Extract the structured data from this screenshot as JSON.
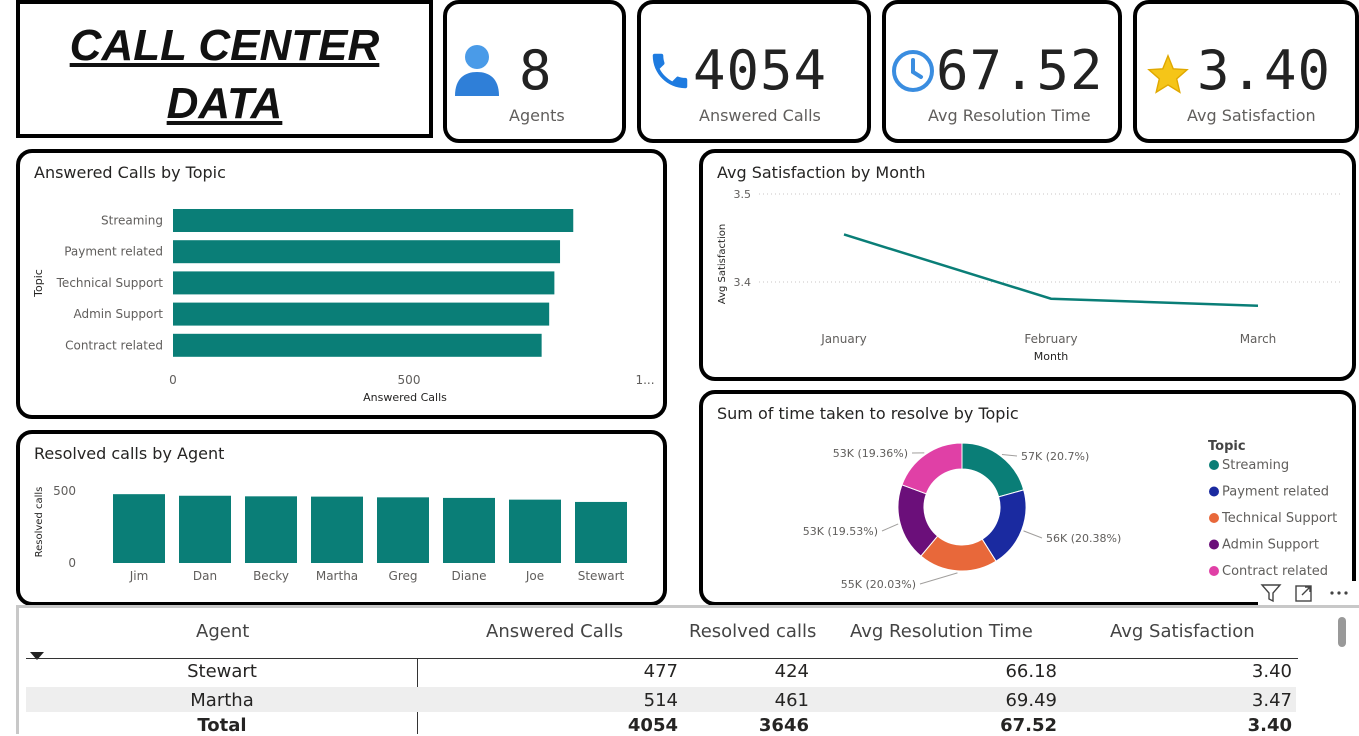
{
  "title": {
    "line1": "CALL CENTER",
    "line2": "DATA"
  },
  "kpis": [
    {
      "value": "8",
      "label": "Agents",
      "icon": "user-icon",
      "color": "#3b82d6"
    },
    {
      "value": "4054",
      "label": "Answered Calls",
      "icon": "phone-icon",
      "color": "#1e7be0"
    },
    {
      "value": "67.52",
      "label": "Avg Resolution Time",
      "icon": "clock-icon",
      "color": "#3a8de0"
    },
    {
      "value": "3.40",
      "label": "Avg Satisfaction",
      "icon": "star-icon",
      "color": "#f5c518"
    }
  ],
  "colors": {
    "teal": "#0a7e77",
    "navy": "#1a2aa0",
    "orange": "#e8683a",
    "purple": "#6b0f7a",
    "pink": "#e040a6"
  },
  "chart_data": [
    {
      "id": "calls-by-topic",
      "type": "bar",
      "orientation": "horizontal",
      "title": "Answered Calls by Topic",
      "xlabel": "Answered Calls",
      "ylabel": "Topic",
      "categories": [
        "Streaming",
        "Payment related",
        "Technical Support",
        "Admin Support",
        "Contract related"
      ],
      "values": [
        848,
        820,
        808,
        797,
        781
      ],
      "xlim": [
        0,
        1000
      ],
      "xticks": [
        "0",
        "500",
        "1..."
      ],
      "color": "#0a7e77"
    },
    {
      "id": "satisfaction-by-month",
      "type": "line",
      "title": "Avg Satisfaction by Month",
      "xlabel": "Month",
      "ylabel": "Avg Satisfaction",
      "categories": [
        "January",
        "February",
        "March"
      ],
      "values": [
        3.454,
        3.381,
        3.373
      ],
      "ylim": [
        3.35,
        3.5
      ],
      "yticks": [
        {
          "v": 3.5,
          "t": "3.5"
        },
        {
          "v": 3.4,
          "t": "3.4"
        }
      ],
      "grid": true,
      "color": "#0a7e77"
    },
    {
      "id": "resolved-by-agent",
      "type": "bar",
      "orientation": "vertical",
      "title": "Resolved calls by Agent",
      "xlabel": "",
      "ylabel": "Resolved calls",
      "categories": [
        "Jim",
        "Dan",
        "Becky",
        "Martha",
        "Greg",
        "Diane",
        "Joe",
        "Stewart"
      ],
      "values": [
        478,
        467,
        463,
        461,
        456,
        452,
        440,
        424
      ],
      "ylim": [
        0,
        550
      ],
      "yticks": [
        {
          "v": 0,
          "t": "0"
        },
        {
          "v": 500,
          "t": "500"
        }
      ],
      "color": "#0a7e77"
    },
    {
      "id": "time-by-topic",
      "type": "pie",
      "donut": true,
      "title": "Sum of time taken to resolve by Topic",
      "legend_title": "Topic",
      "legend_position": "right",
      "slices": [
        {
          "name": "Streaming",
          "value": 20.7,
          "label": "57K (20.7%)",
          "color": "#0a7e77"
        },
        {
          "name": "Payment related",
          "value": 20.38,
          "label": "56K (20.38%)",
          "color": "#1a2aa0"
        },
        {
          "name": "Technical Support",
          "value": 20.03,
          "label": "55K (20.03%)",
          "color": "#e8683a"
        },
        {
          "name": "Admin Support",
          "value": 19.53,
          "label": "53K (19.53%)",
          "color": "#6b0f7a"
        },
        {
          "name": "Contract related",
          "value": 19.36,
          "label": "53K (19.36%)",
          "color": "#e040a6"
        }
      ]
    },
    {
      "id": "agent-table",
      "type": "table",
      "columns": [
        "Agent",
        "Answered Calls",
        "Resolved calls",
        "Avg Resolution Time",
        "Avg Satisfaction"
      ],
      "rows": [
        [
          "Stewart",
          "477",
          "424",
          "66.18",
          "3.40"
        ],
        [
          "Martha",
          "514",
          "461",
          "69.49",
          "3.47"
        ]
      ],
      "total": [
        "Total",
        "4054",
        "3646",
        "67.52",
        "3.40"
      ]
    }
  ]
}
